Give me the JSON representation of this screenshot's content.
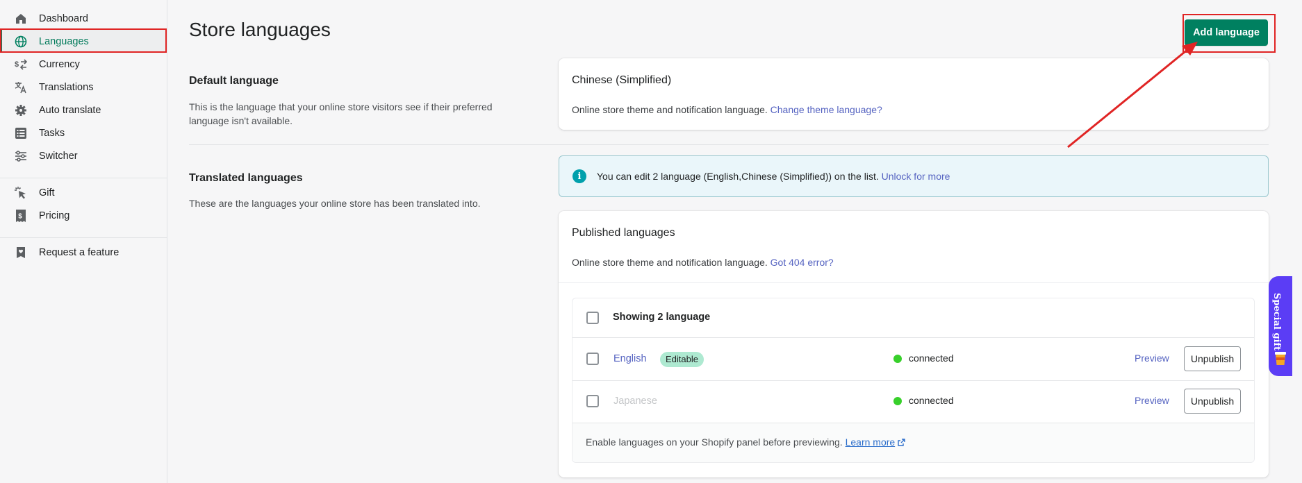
{
  "sidebar": {
    "items": [
      {
        "label": "Dashboard",
        "icon": "home-icon"
      },
      {
        "label": "Languages",
        "icon": "globe-icon"
      },
      {
        "label": "Currency",
        "icon": "currency-exchange-icon"
      },
      {
        "label": "Translations",
        "icon": "translate-icon"
      },
      {
        "label": "Auto translate",
        "icon": "gear-icon"
      },
      {
        "label": "Tasks",
        "icon": "list-icon"
      },
      {
        "label": "Switcher",
        "icon": "sliders-icon"
      },
      {
        "label": "Gift",
        "icon": "click-cursor-icon"
      },
      {
        "label": "Pricing",
        "icon": "receipt-icon"
      },
      {
        "label": "Request a feature",
        "icon": "feedback-icon"
      }
    ],
    "active": "Languages"
  },
  "header": {
    "title": "Store languages",
    "add_button": "Add language"
  },
  "default_section": {
    "title": "Default language",
    "description": "This is the language that your online store visitors see if their preferred language isn't available.",
    "card_title": "Chinese (Simplified)",
    "card_text": "Online store theme and notification language.",
    "card_link": "Change theme language?"
  },
  "translated_section": {
    "title": "Translated languages",
    "description": "These are the languages your online store has been translated into.",
    "banner_text": "You can edit 2 language (English,Chinese (Simplified)) on the list.",
    "banner_link": "Unlock for more",
    "published_title": "Published languages",
    "published_text": "Online store theme and notification language.",
    "published_link": "Got 404 error?",
    "table_header": "Showing 2 language",
    "rows": [
      {
        "name": "English",
        "badge": "Editable",
        "status": "connected",
        "preview": "Preview",
        "action": "Unpublish"
      },
      {
        "name": "Japanese",
        "badge": "",
        "status": "connected",
        "preview": "Preview",
        "action": "Unpublish"
      }
    ],
    "footer_text": "Enable languages on your Shopify panel before previewing.",
    "footer_link": "Learn more"
  },
  "gift_tab": {
    "label": "Special gift"
  },
  "colors": {
    "primary": "#008060",
    "link": "#5563c1",
    "highlight": "#e02424",
    "status_dot": "#38d02b",
    "badge_bg": "#aee9d1",
    "gift_tab": "#5b3df5"
  }
}
